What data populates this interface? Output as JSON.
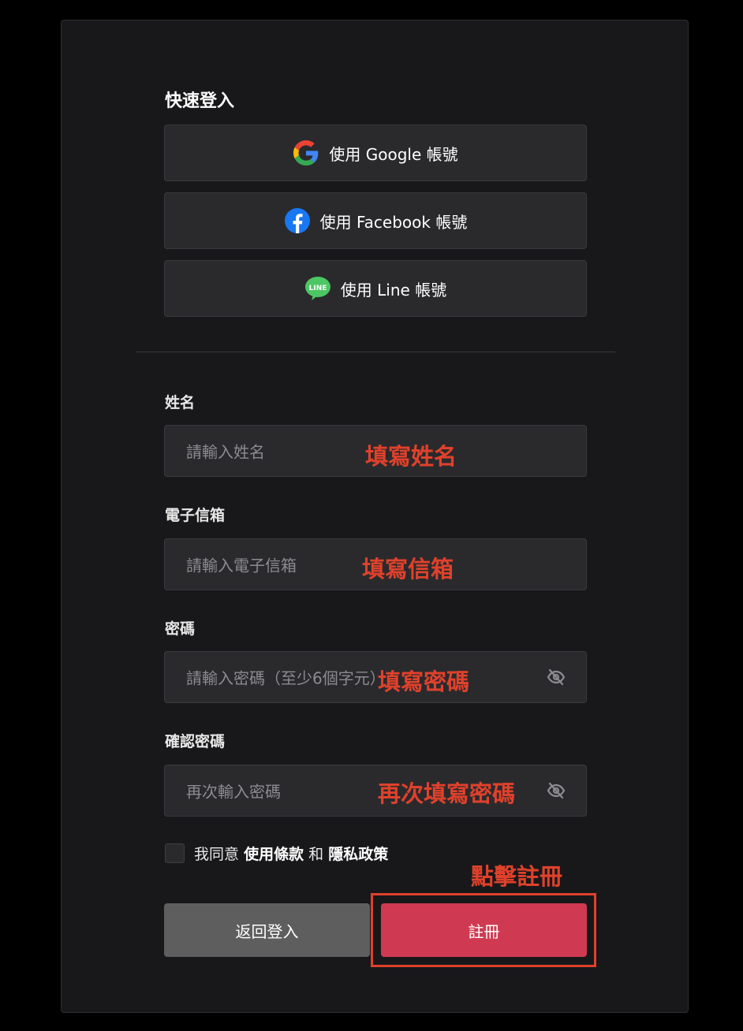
{
  "quick_login": {
    "title": "快速登入",
    "google_label": "使用 Google 帳號",
    "facebook_label": "使用 Facebook 帳號",
    "line_label": "使用 Line 帳號",
    "line_icon_text": "LINE"
  },
  "form": {
    "name_label": "姓名",
    "name_placeholder": "請輸入姓名",
    "email_label": "電子信箱",
    "email_placeholder": "請輸入電子信箱",
    "password_label": "密碼",
    "password_placeholder": "請輸入密碼（至少6個字元）",
    "confirm_label": "確認密碼",
    "confirm_placeholder": "再次輸入密碼",
    "agree_prefix": "我同意",
    "terms_link": "使用條款",
    "and_text": "和",
    "privacy_link": "隱私政策",
    "back_button": "返回登入",
    "register_button": "註冊"
  },
  "annotations": {
    "name": "填寫姓名",
    "email": "填寫信箱",
    "password": "填寫密碼",
    "confirm": "再次填寫密碼",
    "register": "點擊註冊",
    "color": "#e0412b"
  },
  "colors": {
    "background": "#000000",
    "card": "#18181a",
    "input": "#2a2a2d",
    "register_button": "#cf3a52",
    "back_button": "#5e5e5e"
  }
}
